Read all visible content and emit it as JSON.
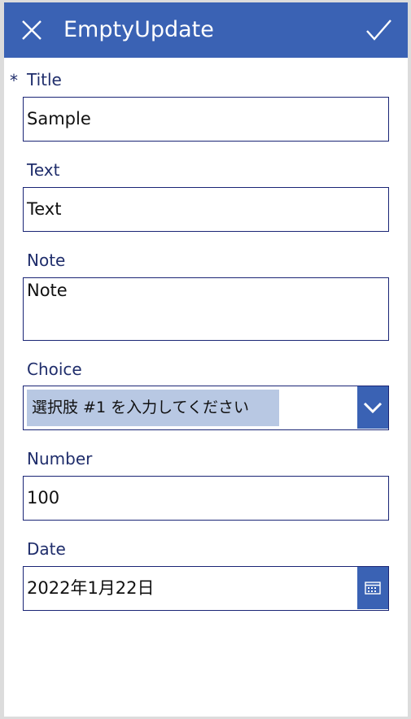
{
  "header": {
    "title": "EmptyUpdate",
    "close_icon": "close-icon",
    "submit_icon": "checkmark-icon",
    "background": "#3a62b4"
  },
  "form": {
    "required_marker": "*",
    "title": {
      "label": "Title",
      "value": "Sample"
    },
    "text": {
      "label": "Text",
      "value": "Text"
    },
    "note": {
      "label": "Note",
      "value": "Note"
    },
    "choice": {
      "label": "Choice",
      "selected": "選択肢 #1 を入力してください",
      "icon": "chevron-down-icon"
    },
    "number": {
      "label": "Number",
      "value": "100"
    },
    "date": {
      "label": "Date",
      "value": "2022年1月22日",
      "icon": "calendar-icon"
    }
  }
}
